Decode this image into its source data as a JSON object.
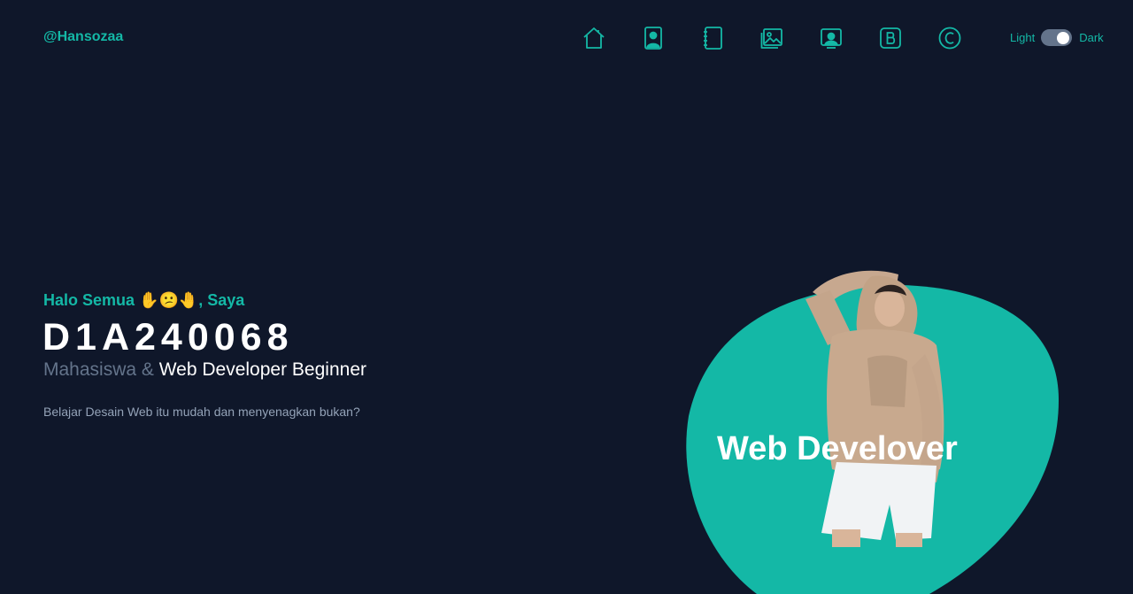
{
  "header": {
    "logo": "@Hansozaa",
    "nav": [
      {
        "icon": "home-icon"
      },
      {
        "icon": "about-icon"
      },
      {
        "icon": "notebook-icon"
      },
      {
        "icon": "gallery-icon"
      },
      {
        "icon": "contact-icon"
      },
      {
        "icon": "blog-icon"
      },
      {
        "icon": "copyright-icon"
      }
    ],
    "theme": {
      "light_label": "Light",
      "dark_label": "Dark",
      "state": "dark"
    }
  },
  "hero": {
    "greeting": "Halo Semua ✋😕🤚, Saya",
    "name": "D1A240068",
    "role_muted": "Mahasiswa &",
    "role_highlight": "Web Developer Beginner",
    "tagline": "Belajar Desain Web itu mudah dan menyenagkan bukan?",
    "image_overlay": "Web Develover"
  },
  "colors": {
    "background": "#0f172a",
    "accent": "#14b8a6",
    "muted": "#64748b",
    "text": "#ffffff"
  }
}
